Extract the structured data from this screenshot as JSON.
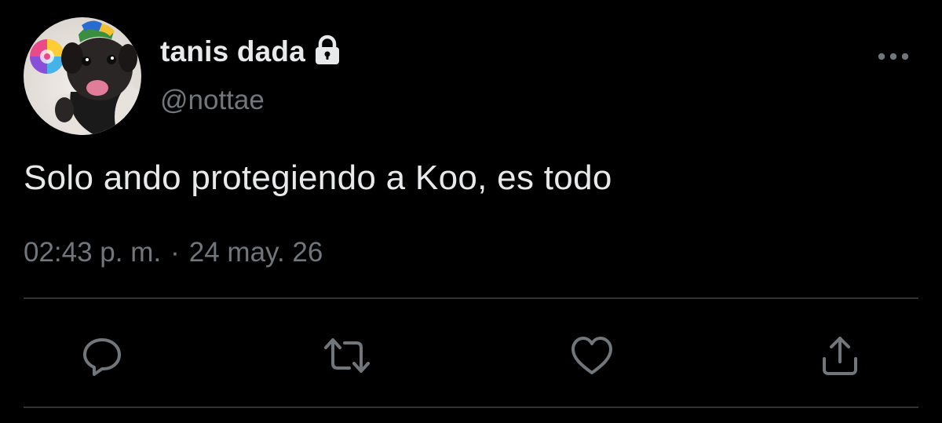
{
  "user": {
    "display_name": "tanis dada",
    "handle": "@nottae",
    "protected": true,
    "avatar": "pug-with-party-hat-avatar"
  },
  "tweet": {
    "text": "Solo ando protegiendo a Koo, es todo",
    "time": "02:43 p. m.",
    "separator": "·",
    "date": "24 may. 26"
  },
  "actions": [
    "reply-icon",
    "retweet-icon",
    "like-icon",
    "share-icon"
  ],
  "colors": {
    "background": "#000000",
    "text_primary": "#e7e9ea",
    "text_secondary": "#71767b",
    "divider": "#2f3336"
  }
}
